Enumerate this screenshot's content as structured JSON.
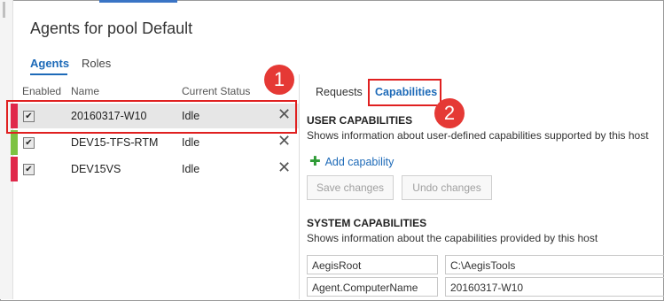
{
  "page": {
    "title": "Agents for pool Default"
  },
  "tabs": {
    "agents": "Agents",
    "roles": "Roles"
  },
  "grid": {
    "headers": {
      "enabled": "Enabled",
      "name": "Name",
      "status": "Current Status"
    },
    "rows": [
      {
        "name": "20160317-W10",
        "status": "Idle",
        "checked": "✔",
        "delete": "✕",
        "status_color": "#e0284a"
      },
      {
        "name": "DEV15-TFS-RTM",
        "status": "Idle",
        "checked": "✔",
        "delete": "✕",
        "status_color": "#7dc242"
      },
      {
        "name": "DEV15VS",
        "status": "Idle",
        "checked": "✔",
        "delete": "✕",
        "status_color": "#e0284a"
      }
    ]
  },
  "callouts": {
    "one": "1",
    "two": "2"
  },
  "right_tabs": {
    "requests": "Requests",
    "capabilities": "Capabilities"
  },
  "user_capabilities": {
    "heading": "USER CAPABILITIES",
    "description": "Shows information about user-defined capabilities supported by this host",
    "add_label": "Add capability",
    "save_label": "Save changes",
    "undo_label": "Undo changes"
  },
  "system_capabilities": {
    "heading": "SYSTEM CAPABILITIES",
    "description": "Shows information about the capabilities provided by this host",
    "items": [
      {
        "key": "AegisRoot",
        "value": "C:\\AegisTools"
      },
      {
        "key": "Agent.ComputerName",
        "value": "20160317-W10"
      }
    ]
  },
  "colors": {
    "accent": "#1d6ab8",
    "highlight": "#e02020",
    "add_icon": "#2e9b36"
  }
}
